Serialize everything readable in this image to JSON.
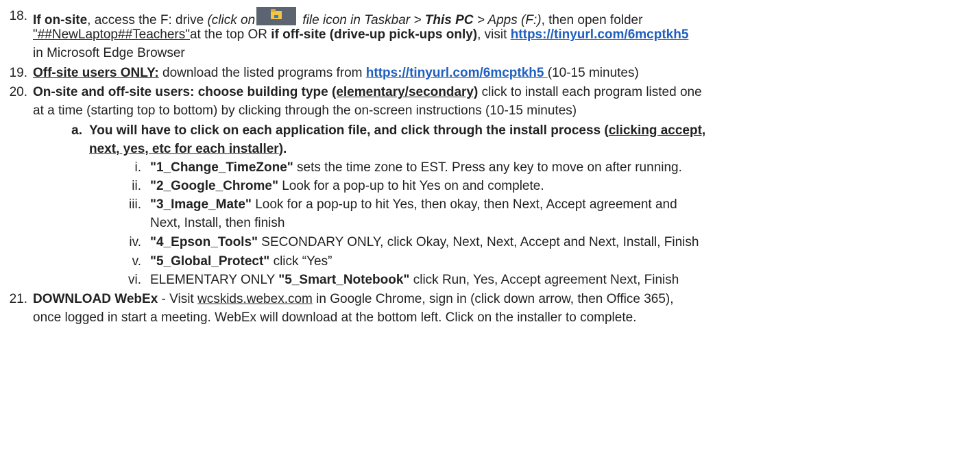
{
  "steps": {
    "s18": {
      "num": "18.",
      "l1_a": "If on-site",
      "l1_b": ", access the F: drive ",
      "l1_c": "(click on",
      "l1_d": " file icon in Taskbar > ",
      "l1_e": "This PC",
      "l1_f": " > Apps (F:)",
      "l1_g": ", then open folder",
      "l2_a": "\"##NewLaptop##Teachers\"",
      "l2_b": "at the top OR ",
      "l2_c": "if off-site (drive-up pick-ups only)",
      "l2_d": ", visit ",
      "l2_link": "https://tinyurl.com/6mcptkh5",
      "l3": "in Microsoft Edge Browser"
    },
    "s19": {
      "num": "19.",
      "a": "Off-site users ONLY:",
      "b": " download the listed programs from ",
      "link": "https://tinyurl.com/6mcptkh5 ",
      "c": "(10-15 minutes)"
    },
    "s20": {
      "num": "20.",
      "a": "On-site and off-site users: choose building type ",
      "b": "(elementary/secondary)",
      "c": " click to install each program listed one",
      "l2": "at a time (starting top to bottom) by clicking through the on-screen instructions (10-15 minutes)"
    },
    "s20a": {
      "num": "a.",
      "a": "You will have to click on each application file, and click through the install process (",
      "b": "clicking accept,",
      "l2_a": "next, yes, etc",
      "l2_b": " for each installer",
      "l2_c": ")."
    },
    "sub": [
      {
        "num": "i.",
        "name": "\"1_Change_TimeZone\"",
        "text": " sets the time zone to EST. Press any key to move on after running."
      },
      {
        "num": "ii.",
        "name": "\"2_Google_Chrome\"",
        "text": " Look for a pop-up to hit Yes on and complete."
      },
      {
        "num": "iii.",
        "name": "\"3_Image_Mate\"",
        "text": " Look for a pop-up to hit Yes, then okay, then Next, Accept agreement and",
        "l2": "Next, Install, then finish"
      },
      {
        "num": "iv.",
        "name": "\"4_Epson_Tools\"",
        "text": " SECONDARY ONLY, click Okay, Next, Next, Accept and Next, Install, Finish"
      },
      {
        "num": "v.",
        "name": "\"5_Global_Protect\"",
        "text": " click “Yes”"
      },
      {
        "num": "vi.",
        "pre": "ELEMENTARY ONLY ",
        "name": "\"5_Smart_Notebook\"",
        "text": " click Run, Yes, Accept agreement Next, Finish"
      }
    ],
    "s21": {
      "num": "21.",
      "a": "DOWNLOAD WebEx",
      "b": " - Visit ",
      "link": "wcskids.webex.com",
      "c": " in Google Chrome, sign in (click down arrow, then Office 365),",
      "l2": "once logged in start a meeting. WebEx will download at the bottom left. Click on the installer to complete."
    }
  },
  "icons": {
    "taskbar_file_icon": "file-explorer-icon"
  },
  "colors": {
    "link": "#1f5fbf",
    "text": "#222222"
  }
}
